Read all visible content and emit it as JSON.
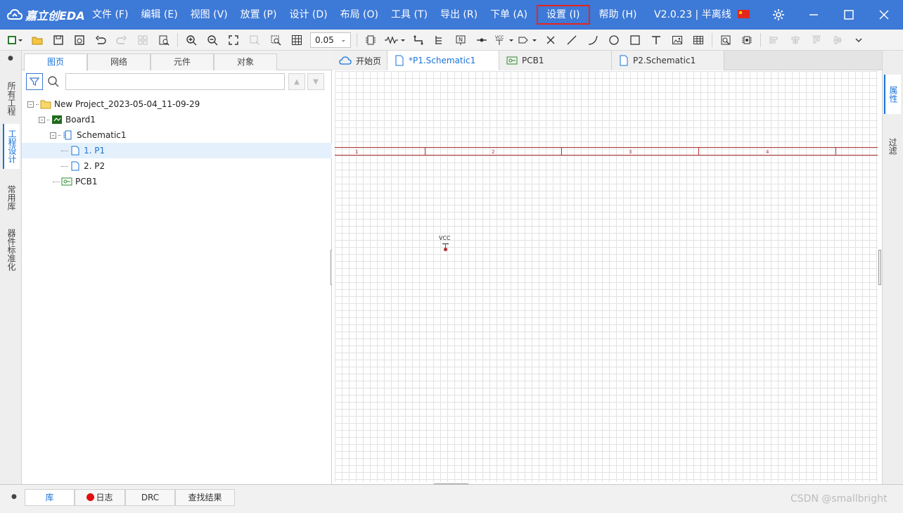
{
  "app": {
    "logo_text": "嘉立创EDA",
    "version": "V2.0.23 | 半离线"
  },
  "menu": [
    {
      "label": "文件 (F)"
    },
    {
      "label": "编辑 (E)"
    },
    {
      "label": "视图 (V)"
    },
    {
      "label": "放置 (P)"
    },
    {
      "label": "设计 (D)"
    },
    {
      "label": "布局 (O)"
    },
    {
      "label": "工具 (T)"
    },
    {
      "label": "导出 (R)"
    },
    {
      "label": "下单 (A)"
    },
    {
      "label": "设置 (I)",
      "highlighted": true
    },
    {
      "label": "帮助 (H)"
    }
  ],
  "toolbar": {
    "grid_size": "0.05"
  },
  "left_strip": {
    "tabs": [
      "所有工程",
      "工程设计",
      "常用库",
      "器件标准化"
    ],
    "active": "工程设计"
  },
  "panel": {
    "tabs": [
      "图页",
      "网络",
      "元件",
      "对象"
    ],
    "active_tab": "图页",
    "search_placeholder": "",
    "tree": [
      {
        "label": "New Project_2023-05-04_11-09-29",
        "level": 0,
        "icon": "folder-icon",
        "toggle": "-"
      },
      {
        "label": "Board1",
        "level": 1,
        "icon": "board-icon",
        "toggle": "-"
      },
      {
        "label": "Schematic1",
        "level": 2,
        "icon": "schematic-icon",
        "toggle": "-"
      },
      {
        "label": "1. P1",
        "level": 3,
        "icon": "page-icon",
        "selected": true
      },
      {
        "label": "2. P2",
        "level": 3,
        "icon": "page-icon"
      },
      {
        "label": "PCB1",
        "level": 2,
        "icon": "pcb-icon"
      }
    ]
  },
  "doc_tabs": [
    {
      "label": "开始页",
      "icon": "cloud-icon"
    },
    {
      "label": "*P1.Schematic1",
      "icon": "page-icon",
      "active": true
    },
    {
      "label": "PCB1",
      "icon": "pcb-icon"
    },
    {
      "label": "P2.Schematic1",
      "icon": "page-icon"
    }
  ],
  "canvas": {
    "zones": [
      "1",
      "2",
      "3",
      "4"
    ],
    "net_label": "VCC"
  },
  "right_strip": {
    "tabs": [
      "属性",
      "过滤"
    ],
    "active": "属性"
  },
  "bottom_tabs": [
    {
      "label": "库",
      "active": true
    },
    {
      "label": "日志",
      "has_dot": true
    },
    {
      "label": "DRC"
    },
    {
      "label": "查找结果"
    }
  ],
  "watermark": "CSDN @smallbright",
  "colors": {
    "titlebar": "#3d79d6",
    "accent": "#1a73d9",
    "highlight_border": "#e8251c",
    "sheet_border": "#b03030"
  }
}
